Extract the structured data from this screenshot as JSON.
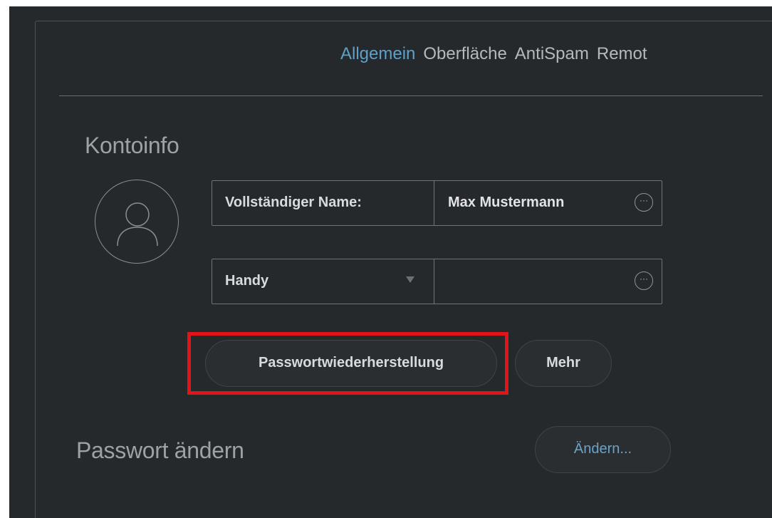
{
  "tabs": [
    {
      "label": "Allgemein",
      "active": true
    },
    {
      "label": "Oberfläche",
      "active": false
    },
    {
      "label": "AntiSpam",
      "active": false
    },
    {
      "label": "Remot",
      "active": false
    }
  ],
  "account": {
    "title": "Kontoinfo",
    "avatar_icon": "user-avatar-icon",
    "name_label": "Vollständiger Name:",
    "name_value": "Max Mustermann",
    "phone_type": "Handy",
    "phone_value": "",
    "more_options_glyph": "···"
  },
  "buttons": {
    "password_recovery": "Passwortwiederherstellung",
    "more": "Mehr"
  },
  "password": {
    "title": "Passwort ändern",
    "change_button": "Ändern..."
  },
  "colors": {
    "background": "#25292c",
    "accent": "#5fa0c8",
    "highlight": "#e1141a"
  }
}
